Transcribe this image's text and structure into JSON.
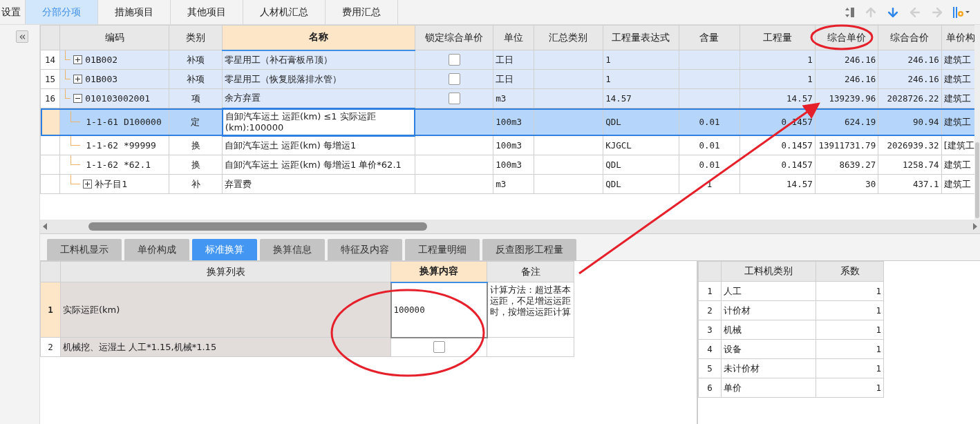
{
  "top_tabs": [
    {
      "label": "设置",
      "selected": false
    },
    {
      "label": "分部分项",
      "selected": true
    },
    {
      "label": "措施项目",
      "selected": false
    },
    {
      "label": "其他项目",
      "selected": false
    },
    {
      "label": "人材机汇总",
      "selected": false
    },
    {
      "label": "费用汇总",
      "selected": false
    }
  ],
  "toolbar": [
    {
      "kind": "sort",
      "disabled": false
    },
    {
      "kind": "up",
      "disabled": true
    },
    {
      "kind": "down",
      "disabled": false
    },
    {
      "kind": "left",
      "disabled": true
    },
    {
      "kind": "right",
      "disabled": true
    },
    {
      "kind": "columns",
      "disabled": false
    }
  ],
  "grid": {
    "columns": [
      {
        "label": "编码",
        "selected": false
      },
      {
        "label": "类别",
        "selected": false
      },
      {
        "label": "名称",
        "selected": true
      },
      {
        "label": "锁定综合单价",
        "selected": false
      },
      {
        "label": "单位",
        "selected": false
      },
      {
        "label": "汇总类别",
        "selected": false
      },
      {
        "label": "工程量表达式",
        "selected": false
      },
      {
        "label": "含量",
        "selected": false
      },
      {
        "label": "工程量",
        "selected": false
      },
      {
        "label": "综合单价",
        "selected": false
      },
      {
        "label": "综合合价",
        "selected": false
      },
      {
        "label": "单价构",
        "selected": false
      }
    ],
    "rows": [
      {
        "no": "14",
        "kind": "bill",
        "code": "01B002",
        "type": "补项",
        "name": "零星用工（补石膏板吊顶）",
        "locked": false,
        "unit": "工日",
        "expr": "1",
        "qty": "1",
        "unit_price": "246.16",
        "total": "246.16",
        "price_comp": "建筑工",
        "expanded": false,
        "selected": false
      },
      {
        "no": "15",
        "kind": "bill",
        "code": "01B003",
        "type": "补项",
        "name": "零星用工（恢复脱落排水管）",
        "locked": false,
        "unit": "工日",
        "expr": "1",
        "qty": "1",
        "unit_price": "246.16",
        "total": "246.16",
        "price_comp": "建筑工",
        "expanded": false,
        "selected": false
      },
      {
        "no": "16",
        "kind": "bill",
        "code": "010103002001",
        "type": "项",
        "name": "余方弃置",
        "locked": false,
        "unit": "m3",
        "expr": "14.57",
        "qty": "14.57",
        "unit_price": "139239.96",
        "total": "2028726.22",
        "price_comp": "建筑工",
        "expanded": true,
        "selected": false,
        "children": [
          {
            "kind": "quota",
            "code": "1-1-61 D100000",
            "type": "定",
            "name": "自卸汽车运土 运距(km) ≤1  实际运距(km):100000",
            "unit": "100m3",
            "expr": "QDL",
            "content": "0.01",
            "qty": "0.1457",
            "unit_price": "624.19",
            "total": "90.94",
            "price_comp": "建筑工",
            "selected": true
          },
          {
            "kind": "quota",
            "code": "1-1-62 *99999",
            "type": "换",
            "name": "自卸汽车运土 运距(km) 每增运1",
            "unit": "100m3",
            "expr": "KJGCL",
            "content": "0.01",
            "qty": "0.1457",
            "unit_price": "13911731.79",
            "total": "2026939.32",
            "price_comp": "[建筑工",
            "selected": false
          },
          {
            "kind": "quota",
            "code": "1-1-62 *62.1",
            "type": "换",
            "name": "自卸汽车运土 运距(km) 每增运1  单价*62.1",
            "unit": "100m3",
            "expr": "QDL",
            "content": "0.01",
            "qty": "0.1457",
            "unit_price": "8639.27",
            "total": "1258.74",
            "price_comp": "建筑工",
            "selected": false
          },
          {
            "kind": "quota",
            "code": "补子目1",
            "type": "补",
            "name": "弃置费",
            "unit": "m3",
            "expr": "QDL",
            "content": "1",
            "qty": "14.57",
            "unit_price": "30",
            "total": "437.1",
            "price_comp": "建筑工",
            "expanded": false,
            "selected": false
          }
        ]
      }
    ]
  },
  "bottom_tabs": [
    {
      "label": "工料机显示",
      "selected": false
    },
    {
      "label": "单价构成",
      "selected": false
    },
    {
      "label": "标准换算",
      "selected": true
    },
    {
      "label": "换算信息",
      "selected": false
    },
    {
      "label": "特征及内容",
      "selected": false
    },
    {
      "label": "工程量明细",
      "selected": false
    },
    {
      "label": "反查图形工程量",
      "selected": false
    }
  ],
  "conversion": {
    "columns": [
      {
        "label": "换算列表",
        "selected": false
      },
      {
        "label": "换算内容",
        "selected": true
      },
      {
        "label": "备注",
        "selected": false
      }
    ],
    "rows": [
      {
        "no": "1",
        "name": "实际运距(km)",
        "kind": "input",
        "value": "100000",
        "note": "计算方法：超过基本运距，不足增运运距时，按增运运距计算",
        "selected": true
      },
      {
        "no": "2",
        "name": "机械挖、运湿土 人工*1.15,机械*1.15",
        "kind": "checkbox",
        "checked": false,
        "selected": false
      }
    ]
  },
  "factors": {
    "columns": [
      "工料机类别",
      "系数"
    ],
    "rows": [
      {
        "no": "1",
        "category": "人工",
        "factor": "1"
      },
      {
        "no": "2",
        "category": "计价材",
        "factor": "1"
      },
      {
        "no": "3",
        "category": "机械",
        "factor": "1"
      },
      {
        "no": "4",
        "category": "设备",
        "factor": "1"
      },
      {
        "no": "5",
        "category": "未计价材",
        "factor": "1"
      },
      {
        "no": "6",
        "category": "单价",
        "factor": "1"
      }
    ]
  }
}
